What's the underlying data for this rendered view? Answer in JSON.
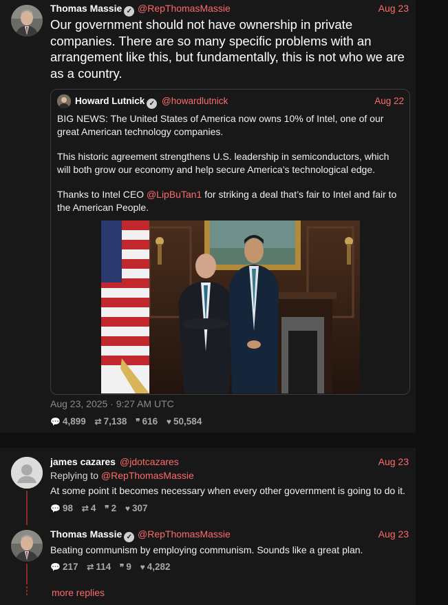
{
  "main_post": {
    "author_name": "Thomas Massie",
    "author_handle": "@RepThomasMassie",
    "date": "Aug 23",
    "text": "Our government should not have ownership in private companies. There are so many specific problems with an arrangement like this, but fundamentally, this is not who we are as a country.",
    "timestamp": "Aug 23, 2025 · 9:27 AM UTC",
    "stats": {
      "replies": "4,899",
      "retweets": "7,138",
      "quotes": "616",
      "likes": "50,584"
    }
  },
  "quote": {
    "author_name": "Howard Lutnick",
    "author_handle": "@howardlutnick",
    "date": "Aug 22",
    "para1": "BIG NEWS: The United States of America now owns 10% of Intel, one of our great American technology companies.",
    "para2": "This historic agreement strengthens U.S. leadership in semiconductors, which will both grow our economy and help secure America’s technological edge.",
    "para3_before": "Thanks to Intel CEO ",
    "para3_mention": "@LipBuTan1",
    "para3_after": " for striking a deal that’s fair to Intel and fair to the American People."
  },
  "replies": [
    {
      "author_name": "james cazares",
      "author_handle": "@jdotcazares",
      "date": "Aug 23",
      "replying_label": "Replying to ",
      "replying_to": "@RepThomasMassie",
      "text": "At some point it becomes necessary when every other government is going to do it.",
      "stats": {
        "replies": "98",
        "retweets": "4",
        "quotes": "2",
        "likes": "307"
      }
    },
    {
      "author_name": "Thomas Massie",
      "author_handle": "@RepThomasMassie",
      "date": "Aug 23",
      "text": "Beating communism by employing communism. Sounds like a great plan.",
      "stats": {
        "replies": "217",
        "retweets": "114",
        "quotes": "9",
        "likes": "4,282"
      }
    }
  ],
  "more_replies_label": "more replies",
  "icons": {
    "reply": "comment-icon",
    "retweet": "retweet-icon",
    "quote": "quote-icon",
    "like": "heart-icon",
    "verified": "verified-badge-icon"
  },
  "colors": {
    "accent": "#ff6a6a",
    "background": "#0f0f0f",
    "panel": "#181818"
  }
}
